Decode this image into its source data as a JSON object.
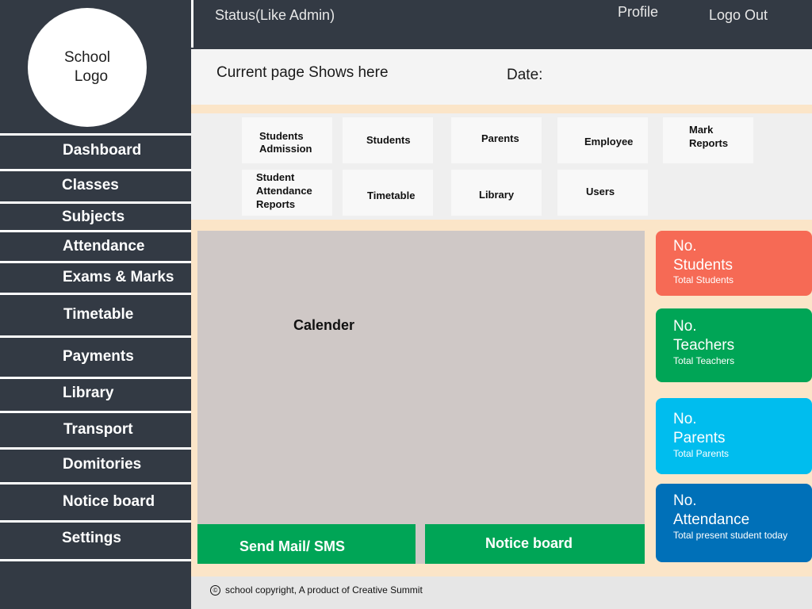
{
  "sidebar": {
    "logo_line1": "School",
    "logo_line2": "Logo",
    "items": [
      {
        "label": "Dashboard"
      },
      {
        "label": "Classes"
      },
      {
        "label": "Subjects"
      },
      {
        "label": "Attendance"
      },
      {
        "label": "Exams & Marks"
      },
      {
        "label": "Timetable"
      },
      {
        "label": "Payments"
      },
      {
        "label": "Library"
      },
      {
        "label": "Transport"
      },
      {
        "label": "Domitories"
      },
      {
        "label": "Notice board"
      },
      {
        "label": "Settings"
      }
    ]
  },
  "header": {
    "status": "Status(Like Admin)",
    "profile": "Profile",
    "logout": "Logo Out"
  },
  "pagebar": {
    "current_page": "Current page Shows here",
    "date_label": "Date:"
  },
  "quick_links": {
    "students_admission_1": "Students",
    "students_admission_2": "Admission",
    "students": "Students",
    "parents": "Parents",
    "employee": "Employee",
    "mark_reports_1": "Mark",
    "mark_reports_2": "Reports",
    "attendance_reports_1": "Student",
    "attendance_reports_2": "Attendance",
    "attendance_reports_3": "Reports",
    "timetable": "Timetable",
    "library": "Library",
    "users": "Users"
  },
  "calendar": {
    "label": "Calender"
  },
  "actions": {
    "send_mail": "Send Mail/ SMS",
    "notice_board": "Notice board"
  },
  "stats": [
    {
      "num": "No.",
      "label": "Students",
      "sub": "Total Students",
      "color": "#f66a55"
    },
    {
      "num": "No.",
      "label": "Teachers",
      "sub": "Total Teachers",
      "color": "#00a556"
    },
    {
      "num": "No.",
      "label": "Parents",
      "sub": "Total Parents",
      "color": "#00bdee"
    },
    {
      "num": "No.",
      "label": "Attendance",
      "sub": "Total present student today",
      "color": "#0070b8"
    }
  ],
  "footer": {
    "copyright_symbol": "©",
    "text": "school copyright,  A product of Creative Summit"
  },
  "colors": {
    "sidebar_bg": "#333a44",
    "accent_green": "#00a556",
    "peach_bg": "#fbe5c8"
  }
}
